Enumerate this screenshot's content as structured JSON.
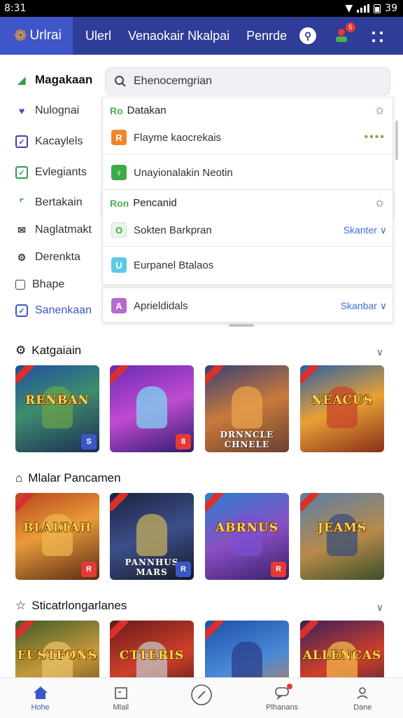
{
  "status_bar": {
    "time": "8:31",
    "right_text": "39"
  },
  "header": {
    "logo_text": "Urlrai",
    "nav": [
      "Ulerl",
      "Venaokair Nkalpai",
      "Penrde"
    ],
    "notification_count": "5",
    "icons": {
      "key": "key-icon",
      "user": "user-icon",
      "more": "more-grid-icon"
    }
  },
  "sidebar": {
    "items": [
      {
        "label": "Magakaan",
        "icon": "tag-icon",
        "color": "#2e9e4f"
      },
      {
        "label": "Nulognai",
        "icon": "heart-icon",
        "color": "#6a3bb8"
      },
      {
        "label": "Kacaylels",
        "icon": "checkbox-icon",
        "color": "#4c3bb0"
      },
      {
        "label": "Evlegiants",
        "icon": "check-circle-icon",
        "color": "#2e9e4f"
      },
      {
        "label": "Bertakain",
        "icon": "bracket-icon",
        "color": "#2e9e4f"
      },
      {
        "label": "Naglatmakt",
        "icon": "mail-icon",
        "color": "#444444"
      },
      {
        "label": "Derenkta",
        "icon": "gear-icon",
        "color": "#444444"
      },
      {
        "label": "Bhape",
        "icon": "square-icon",
        "color": "#444444"
      },
      {
        "label": "Sanenkaan",
        "icon": "clock-icon",
        "color": "#3a57c4"
      }
    ]
  },
  "search": {
    "value": "Ehenocemgrian",
    "sections": [
      {
        "heading_glyph": "Ro",
        "heading": "Datakan",
        "rows": [
          {
            "label": "Flayme kaocrekais",
            "color": "#f0862c",
            "glyph": "R",
            "trail": "••••"
          },
          {
            "label": "Unayionalakin Neotin",
            "color": "#3faa4a",
            "glyph": "♀",
            "trail": ""
          }
        ]
      },
      {
        "heading_glyph": "Ron",
        "heading": "Pencanid",
        "rows": [
          {
            "label": "Sokten Barkpran",
            "color": "#e8f4ea",
            "glyph": "O",
            "trail": "Skanter ∨"
          },
          {
            "label": "Eurpanel Btalaos",
            "color": "#5cc8e3",
            "glyph": "U",
            "trail": ""
          }
        ]
      },
      {
        "heading_glyph": "",
        "heading": "",
        "rows": [
          {
            "label": "Aprieldidals",
            "color": "#b56ad1",
            "glyph": "A",
            "trail": "Skanbar ∨"
          }
        ]
      }
    ]
  },
  "sections": [
    {
      "title": "Katgaiain",
      "icon": "gear-icon",
      "tiles": [
        {
          "text": "RENBAN",
          "bg": "linear-gradient(160deg,#1f4f9e 0%,#3d8d6e 45%,#1c2d55 100%)",
          "hero": "#6aa24a",
          "badge": "#3a57c4",
          "badge_text": "S"
        },
        {
          "text": "",
          "bg": "linear-gradient(160deg,#6a2bb5 0%,#c04bd0 50%,#2b1c6e 100%)",
          "hero": "#7dd6f2",
          "badge": "#e53935",
          "badge_text": "8"
        },
        {
          "text": "DRNNCLE CHNELE",
          "bg": "linear-gradient(160deg,#3a3f76 0%,#c87a3b 50%,#6b3f2f 100%)",
          "hero": "#e9a34c",
          "badge": "",
          "badge_text": ""
        },
        {
          "text": "NEACUS",
          "bg": "linear-gradient(160deg,#2c5fa6 0%,#e8a134 50%,#8a2e1b 100%)",
          "hero": "#c9432a",
          "badge": "",
          "badge_text": ""
        }
      ]
    },
    {
      "title": "Mlalar Pancamen",
      "icon": "bracket-icon",
      "tiles": [
        {
          "text": "BLALTAH",
          "bg": "linear-gradient(160deg,#b7451b 0%,#e99b3a 45%,#5a2a15 100%)",
          "hero": "#f0b54c",
          "badge": "#e53935",
          "badge_text": "R"
        },
        {
          "text": "PANNHUS MARS",
          "bg": "linear-gradient(160deg,#1c2340 0%,#3c4f8a 50%,#141824 100%)",
          "hero": "#c6ad5a",
          "badge": "#3a57c4",
          "badge_text": "R"
        },
        {
          "text": "ABRNUS",
          "bg": "linear-gradient(160deg,#2a7fd0 0%,#8a4fc4 50%,#3a1f6a 100%)",
          "hero": "#7a4fd0",
          "badge": "#e53935",
          "badge_text": "R"
        },
        {
          "text": "JEAMS",
          "bg": "linear-gradient(160deg,#5a7fa8 0%,#b78a4a 55%,#3b4f2a 100%)",
          "hero": "#3a4f7a",
          "badge": "",
          "badge_text": ""
        }
      ]
    },
    {
      "title": "Sticatrlongarlanes",
      "icon": "star-icon",
      "tiles": [
        {
          "text": "FUSTFONS",
          "bg": "linear-gradient(160deg,#3f5a2a 0%,#c69a3a 50%,#5a3a1f 100%)",
          "hero": "#e5c26a",
          "badge": "",
          "badge_text": ""
        },
        {
          "text": "CTTERIS",
          "bg": "linear-gradient(160deg,#6a1a1a 0%,#d0402a 50%,#2a1010 100%)",
          "hero": "#c4c4c4",
          "badge": "",
          "badge_text": ""
        },
        {
          "text": "",
          "bg": "linear-gradient(160deg,#1f4fa6 0%,#4a8ad8 50%,#e07a2a 100%)",
          "hero": "#2a3f8a",
          "badge": "",
          "badge_text": ""
        },
        {
          "text": "ALLENCAS",
          "bg": "linear-gradient(160deg,#3a1f5a 0%,#d0402a 50%,#2a1a3f 100%)",
          "hero": "#f0b54c",
          "badge": "",
          "badge_text": ""
        }
      ]
    }
  ],
  "bottom_nav": [
    {
      "label": "Hohe",
      "icon": "home-icon",
      "active": true
    },
    {
      "label": "Mlail",
      "icon": "calendar-icon",
      "active": false
    },
    {
      "label": "",
      "icon": "compass-icon",
      "active": false
    },
    {
      "label": "Plhanans",
      "icon": "chat-icon",
      "active": false
    },
    {
      "label": "Dane",
      "icon": "profile-icon",
      "active": false
    }
  ],
  "colors": {
    "header_bg": "#2f3d98",
    "logo_bg": "#3f56c9",
    "accent": "#3a57c4",
    "alert": "#e53935"
  }
}
